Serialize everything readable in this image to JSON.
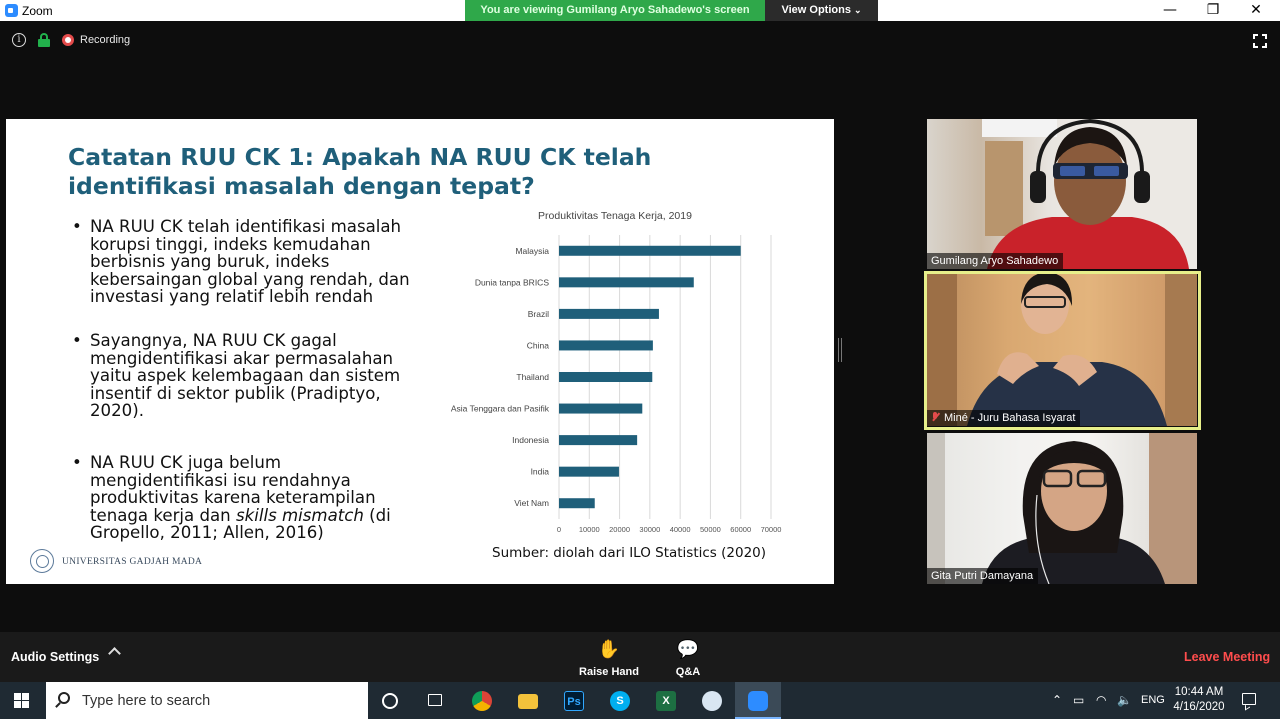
{
  "window": {
    "app_title": "Zoom",
    "banner": "You are viewing Gumilang Aryo Sahadewo's screen",
    "view_options": "View Options",
    "minimize": "—",
    "restore": "❐",
    "close": "✕"
  },
  "meeting_bar": {
    "info": "i",
    "recording": "Recording"
  },
  "slide": {
    "title": "Catatan RUU CK 1: Apakah NA RUU CK telah identifikasi masalah dengan tepat?",
    "bullet_mark": "•",
    "bullets": [
      "NA RUU CK telah identifikasi masalah korupsi tinggi, indeks kemudahan berbisnis yang buruk, indeks kebersaingan global yang rendah, dan investasi yang relatif lebih rendah",
      "Sayangnya, NA RUU CK gagal mengidentifikasi akar permasalahan yaitu aspek kelembagaan dan sistem insentif di sektor publik (Pradiptyo, 2020).",
      {
        "before": "NA RUU CK juga belum mengidentifikasi isu rendahnya produktivitas karena keterampilan tenaga kerja dan ",
        "italic": "skills mismatch",
        "after": " (di Gropello, 2011; Allen, 2016)"
      }
    ],
    "source": "Sumber: diolah dari ILO Statistics (2020)",
    "university": "UNIVERSITAS GADJAH MADA"
  },
  "chart_data": {
    "type": "bar",
    "orientation": "horizontal",
    "title": "Produktivitas Tenaga Kerja, 2019",
    "categories": [
      "Malaysia",
      "Dunia tanpa BRICS",
      "Brazil",
      "China",
      "Thailand",
      "Asia Tenggara dan Pasifik",
      "Indonesia",
      "India",
      "Viet Nam"
    ],
    "values": [
      60000,
      44500,
      33000,
      31000,
      30800,
      27500,
      25800,
      19800,
      11800
    ],
    "xlim": [
      0,
      70000
    ],
    "ticks": [
      0,
      10000,
      20000,
      30000,
      40000,
      50000,
      60000,
      70000
    ],
    "grid": true,
    "bar_color": "#1f5f7a",
    "grid_color": "#d9d9d9"
  },
  "participants": [
    {
      "name": "Gumilang Aryo Sahadewo",
      "muted": false
    },
    {
      "name": "Miné - Juru Bahasa Isyarat",
      "muted": true,
      "active_speaker": true
    },
    {
      "name": "Gita Putri Damayana",
      "muted": false
    }
  ],
  "controls": {
    "audio_settings": "Audio Settings",
    "raise_hand": "Raise Hand",
    "qa": "Q&A",
    "leave": "Leave Meeting"
  },
  "taskbar": {
    "search_placeholder": "Type here to search",
    "apps": [
      "cortana-icon",
      "task-view-icon",
      "chrome-icon",
      "file-explorer-icon",
      "photoshop-icon",
      "skype-icon",
      "excel-icon",
      "paint-icon",
      "zoom-icon"
    ],
    "tray_language": "ENG",
    "time": "10:44 AM",
    "date": "4/16/2020"
  },
  "colors": {
    "slide_title": "#1f5f7a",
    "banner": "#2fa84a",
    "leave": "#ff4d4d",
    "active_speaker_border": "#e7ef8a"
  }
}
